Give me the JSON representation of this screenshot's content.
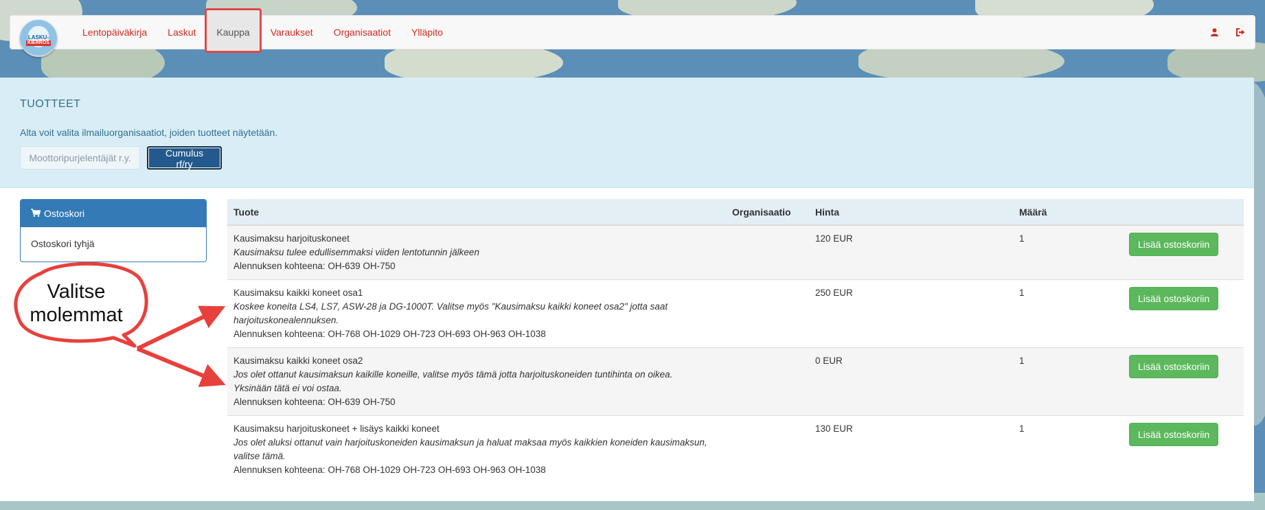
{
  "nav": {
    "logo_line1": "LASKU-",
    "logo_line2": "KIERROS",
    "items": [
      {
        "label": "Lentopäiväkirja"
      },
      {
        "label": "Laskut"
      },
      {
        "label": "Kauppa"
      },
      {
        "label": "Varaukset"
      },
      {
        "label": "Organisaatiot"
      },
      {
        "label": "Ylläpito"
      }
    ],
    "active_item": "Kauppa",
    "user_icon": "user-icon",
    "logout_icon": "sign-out-icon"
  },
  "header": {
    "title": "TUOTTEET",
    "description": "Alta voit valita ilmailuorganisaatiot, joiden tuotteet näytetään.",
    "org_buttons": [
      {
        "label": "Moottoripurjelentäjät r.y.",
        "selected": false
      },
      {
        "label": "Cumulus rf/ry",
        "selected": true
      }
    ]
  },
  "cart": {
    "title": "Ostoskori",
    "icon": "shopping-cart-icon",
    "empty_text": "Ostoskori tyhjä"
  },
  "table": {
    "columns": [
      "Tuote",
      "Organisaatio",
      "Hinta",
      "Määrä",
      ""
    ],
    "add_label": "Lisää ostoskoriin",
    "rows": [
      {
        "name": "Kausimaksu harjoituskoneet",
        "desc1": "Kausimaksu tulee edullisemmaksi viiden lentotunnin jälkeen",
        "desc2": "",
        "discount": "Alennuksen kohteena: OH-639 OH-750",
        "org": "",
        "price": "120 EUR",
        "qty": "1"
      },
      {
        "name": "Kausimaksu kaikki koneet osa1",
        "desc1": "Koskee koneita LS4, LS7, ASW-28 ja DG-1000T. Valitse myös \"Kausimaksu kaikki koneet osa2\" jotta saat",
        "desc2": "harjoituskonealennuksen.",
        "discount": "Alennuksen kohteena: OH-768 OH-1029 OH-723 OH-693 OH-963 OH-1038",
        "org": "",
        "price": "250 EUR",
        "qty": "1"
      },
      {
        "name": "Kausimaksu kaikki koneet osa2",
        "desc1": "Jos olet ottanut kausimaksun kaikille koneille, valitse myös tämä jotta harjoituskoneiden tuntihinta on oikea.",
        "desc2": "Yksinään tätä ei voi ostaa.",
        "discount": "Alennuksen kohteena: OH-639 OH-750",
        "org": "",
        "price": "0 EUR",
        "qty": "1"
      },
      {
        "name": "Kausimaksu harjoituskoneet + lisäys kaikki koneet",
        "desc1": "Jos olet aluksi ottanut vain harjoituskoneiden kausimaksun ja haluat maksaa myös kaikkien koneiden kausimaksun,",
        "desc2": "valitse tämä.",
        "discount": "Alennuksen kohteena: OH-768 OH-1029 OH-723 OH-693 OH-963 OH-1038",
        "org": "",
        "price": "130 EUR",
        "qty": "1"
      }
    ]
  },
  "annotation": {
    "line1": "Valitse",
    "line2": "molemmat",
    "color": "#e8403c"
  },
  "colors": {
    "nav_link": "#d22a1e",
    "primary": "#337ab7",
    "success": "#5cb85c",
    "info_bg": "#d9edf7",
    "info_text": "#31708f"
  }
}
